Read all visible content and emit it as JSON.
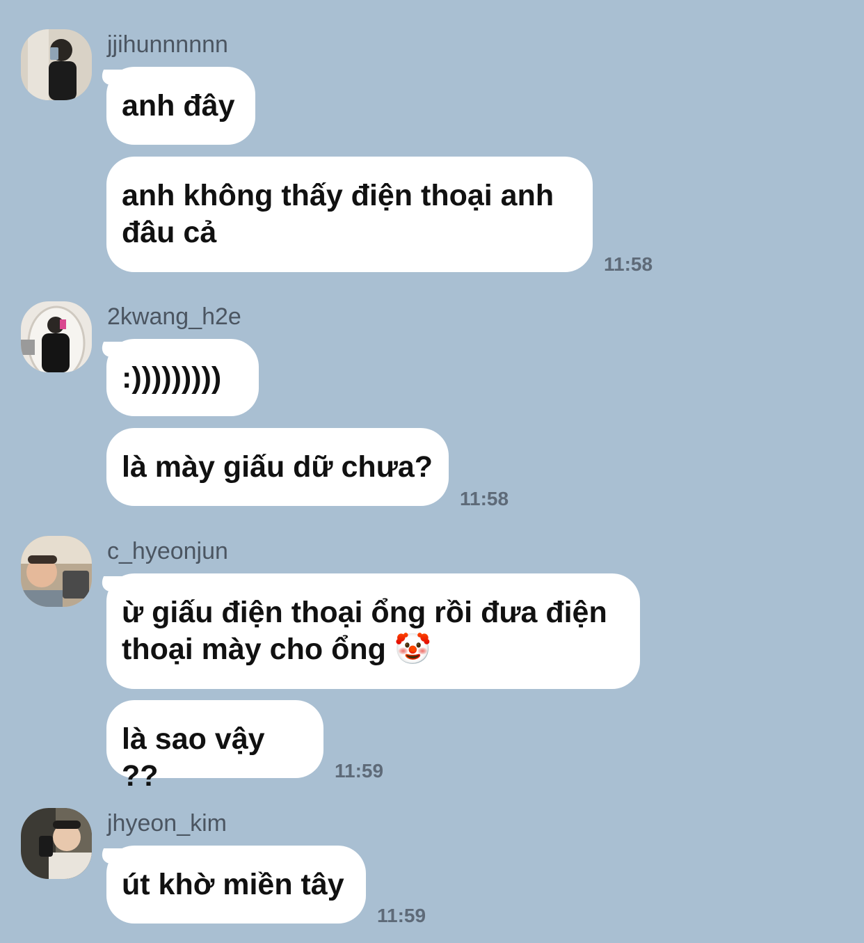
{
  "conversation": {
    "groups": [
      {
        "username": "jjihunnnnnn",
        "avatar_icon": "user-avatar-photo",
        "messages": [
          "anh đây",
          "anh không thấy điện thoại anh\nđâu cả"
        ],
        "time": "11:58"
      },
      {
        "username": "2kwang_h2e",
        "avatar_icon": "user-avatar-photo",
        "messages": [
          ":)))))))))",
          "là mày giấu dữ chưa?"
        ],
        "time": "11:58"
      },
      {
        "username": "c_hyeonjun",
        "avatar_icon": "user-avatar-photo",
        "messages": [
          "ừ giấu điện thoại ổng rồi đưa điện\nthoại mày cho ổng 🤡",
          "là sao vậy ??"
        ],
        "time": "11:59"
      },
      {
        "username": "jhyeon_kim",
        "avatar_icon": "user-avatar-photo",
        "messages": [
          "út khờ miền tây"
        ],
        "time": "11:59"
      }
    ]
  },
  "colors": {
    "background": "#a9bfd2",
    "bubble": "#ffffff",
    "username_text": "#4b5561",
    "timestamp_text": "#5e6a78"
  }
}
